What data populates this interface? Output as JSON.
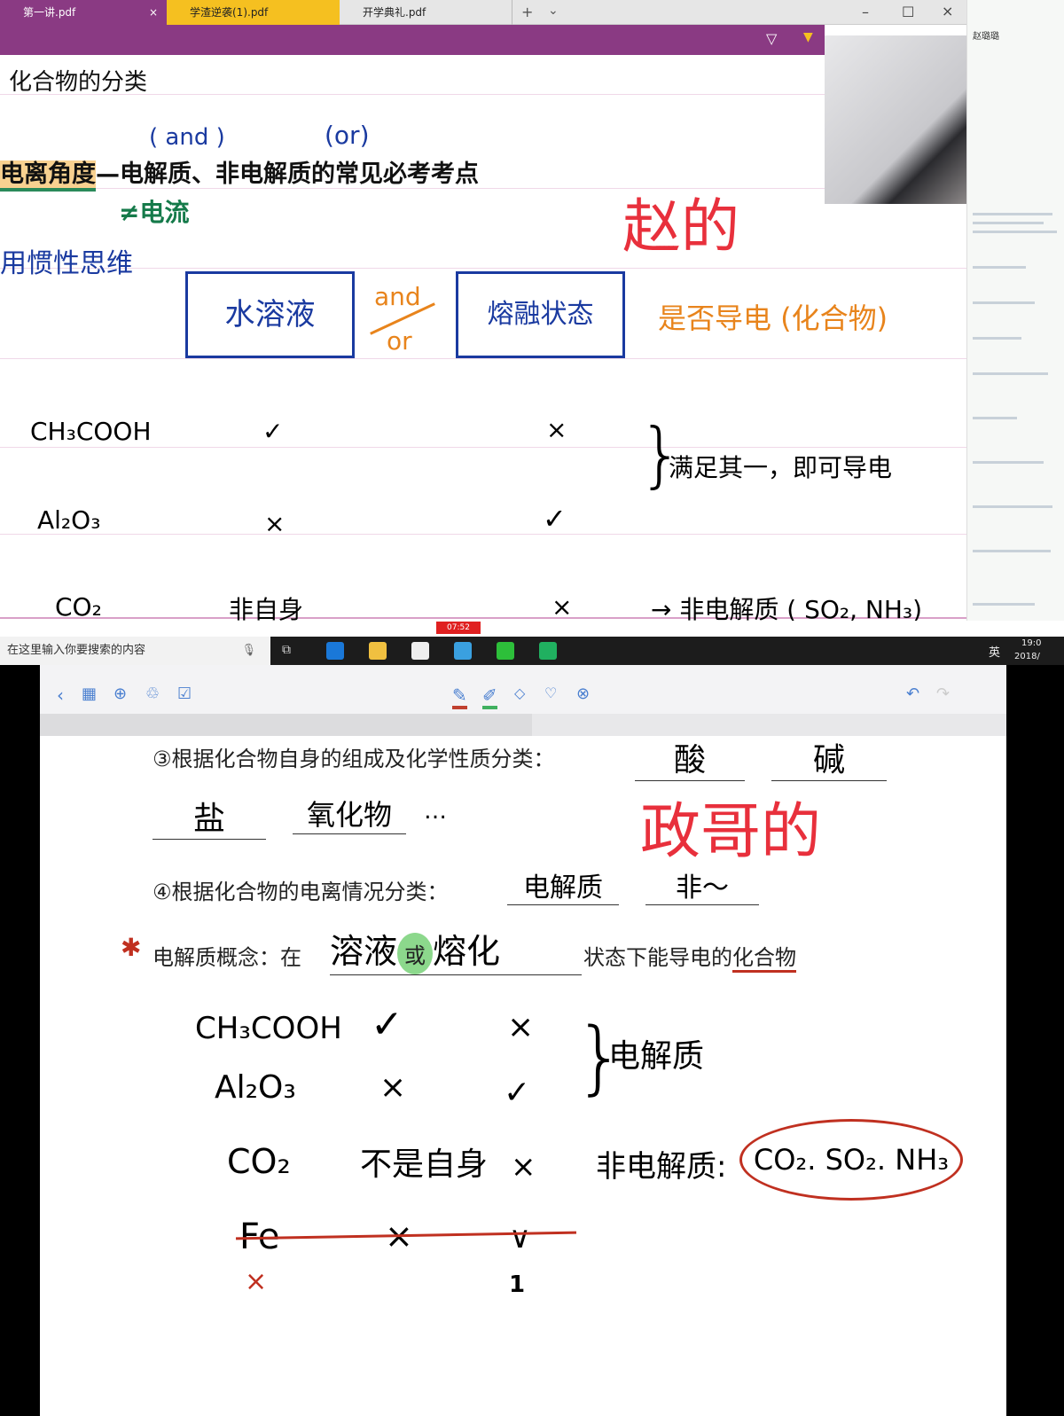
{
  "tabs": [
    {
      "label": "第一讲.pdf",
      "close": "×"
    },
    {
      "label": "学渣逆袭(1).pdf"
    },
    {
      "label": "开学典礼.pdf"
    }
  ],
  "tabbar": {
    "new_tab": "+",
    "dropdown": "⌄",
    "minimize": "–",
    "maximize": "☐",
    "close": "×"
  },
  "chat": {
    "user": "赵璐璐"
  },
  "page": {
    "title": "化合物的分类",
    "heading_highlight": "电离角度",
    "heading_rest": "—电解质、非电解质的常见必考考点",
    "note_and": "( and )",
    "note_or": "(or)",
    "note_current": "≠电流",
    "note_habit": "用惯性思维",
    "label_zhao": "赵的",
    "box1": "水溶液",
    "andor_top": "and",
    "andor_bottom": "or",
    "box2": "熔融状态",
    "conduct": "是否导电 (化合物)",
    "rows": [
      {
        "formula": "CH₃COOH",
        "aq": "✓",
        "melt": "×"
      },
      {
        "formula": "Al₂O₃",
        "aq": "×",
        "melt": "✓"
      },
      {
        "formula": "CO₂",
        "aq": "非自身",
        "melt": "×"
      }
    ],
    "brace_note": "满足其一，即可导电",
    "nonelectrolyte_note": "→ 非电解质 ( SO₂, NH₃)"
  },
  "strip": {
    "timer": "07:52"
  },
  "taskbar": {
    "search_placeholder": "在这里输入你要搜索的内容",
    "ime": "英",
    "time": "19:0",
    "date": "2018/"
  },
  "ipad": {
    "line3_text": "③根据化合物自身的组成及化学性质分类：",
    "acid": "酸",
    "base": "碱",
    "salt": "盐",
    "oxide": "氧化物",
    "ellipsis": "…",
    "label_zheng": "政哥的",
    "line4_text": "④根据化合物的电离情况分类：",
    "electrolyte": "电解质",
    "non": "非～",
    "concept_prefix": "电解质概念：在",
    "solution": "溶液",
    "or": "或",
    "molten": "熔化",
    "concept_suffix": "状态下能导电的",
    "compound": "化合物",
    "rows": [
      {
        "formula": "CH₃COOH",
        "aq": "✓",
        "melt": "×"
      },
      {
        "formula": "Al₂O₃",
        "aq": "×",
        "melt": "✓"
      },
      {
        "formula": "CO₂",
        "aq": "不是自身",
        "melt": "×"
      },
      {
        "formula": "Fe",
        "aq": "×",
        "melt": "∨"
      }
    ],
    "brace_note": "电解质",
    "nonelec_label": "非电解质:",
    "nonelec_list": "CO₂. SO₂. NH₃",
    "fe_mark": "×",
    "fe_number": "1"
  }
}
